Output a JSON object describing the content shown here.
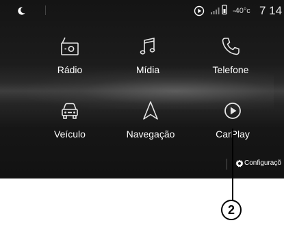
{
  "status_bar": {
    "icons": [
      "moon-icon",
      "carplay-status-icon",
      "signal-icon",
      "phone-battery-icon"
    ],
    "temperature": "-40°c",
    "clock": "7 14"
  },
  "menu": {
    "tiles": [
      {
        "label": "Rádio",
        "icon": "radio-icon"
      },
      {
        "label": "Mídia",
        "icon": "music-note-icon"
      },
      {
        "label": "Telefone",
        "icon": "phone-icon"
      },
      {
        "label": "Veículo",
        "icon": "car-icon"
      },
      {
        "label": "Navegação",
        "icon": "navigation-arrow-icon"
      },
      {
        "label": "CarPlay",
        "icon": "carplay-icon"
      }
    ]
  },
  "footer": {
    "settings_label": "Configuraçõ",
    "settings_icon": "gear-icon"
  },
  "callout": {
    "number": "2"
  },
  "colors": {
    "screen_background": "#141414",
    "icon_stroke": "#e6e6e6",
    "label_text": "#ffffff",
    "callout": "#000000"
  }
}
